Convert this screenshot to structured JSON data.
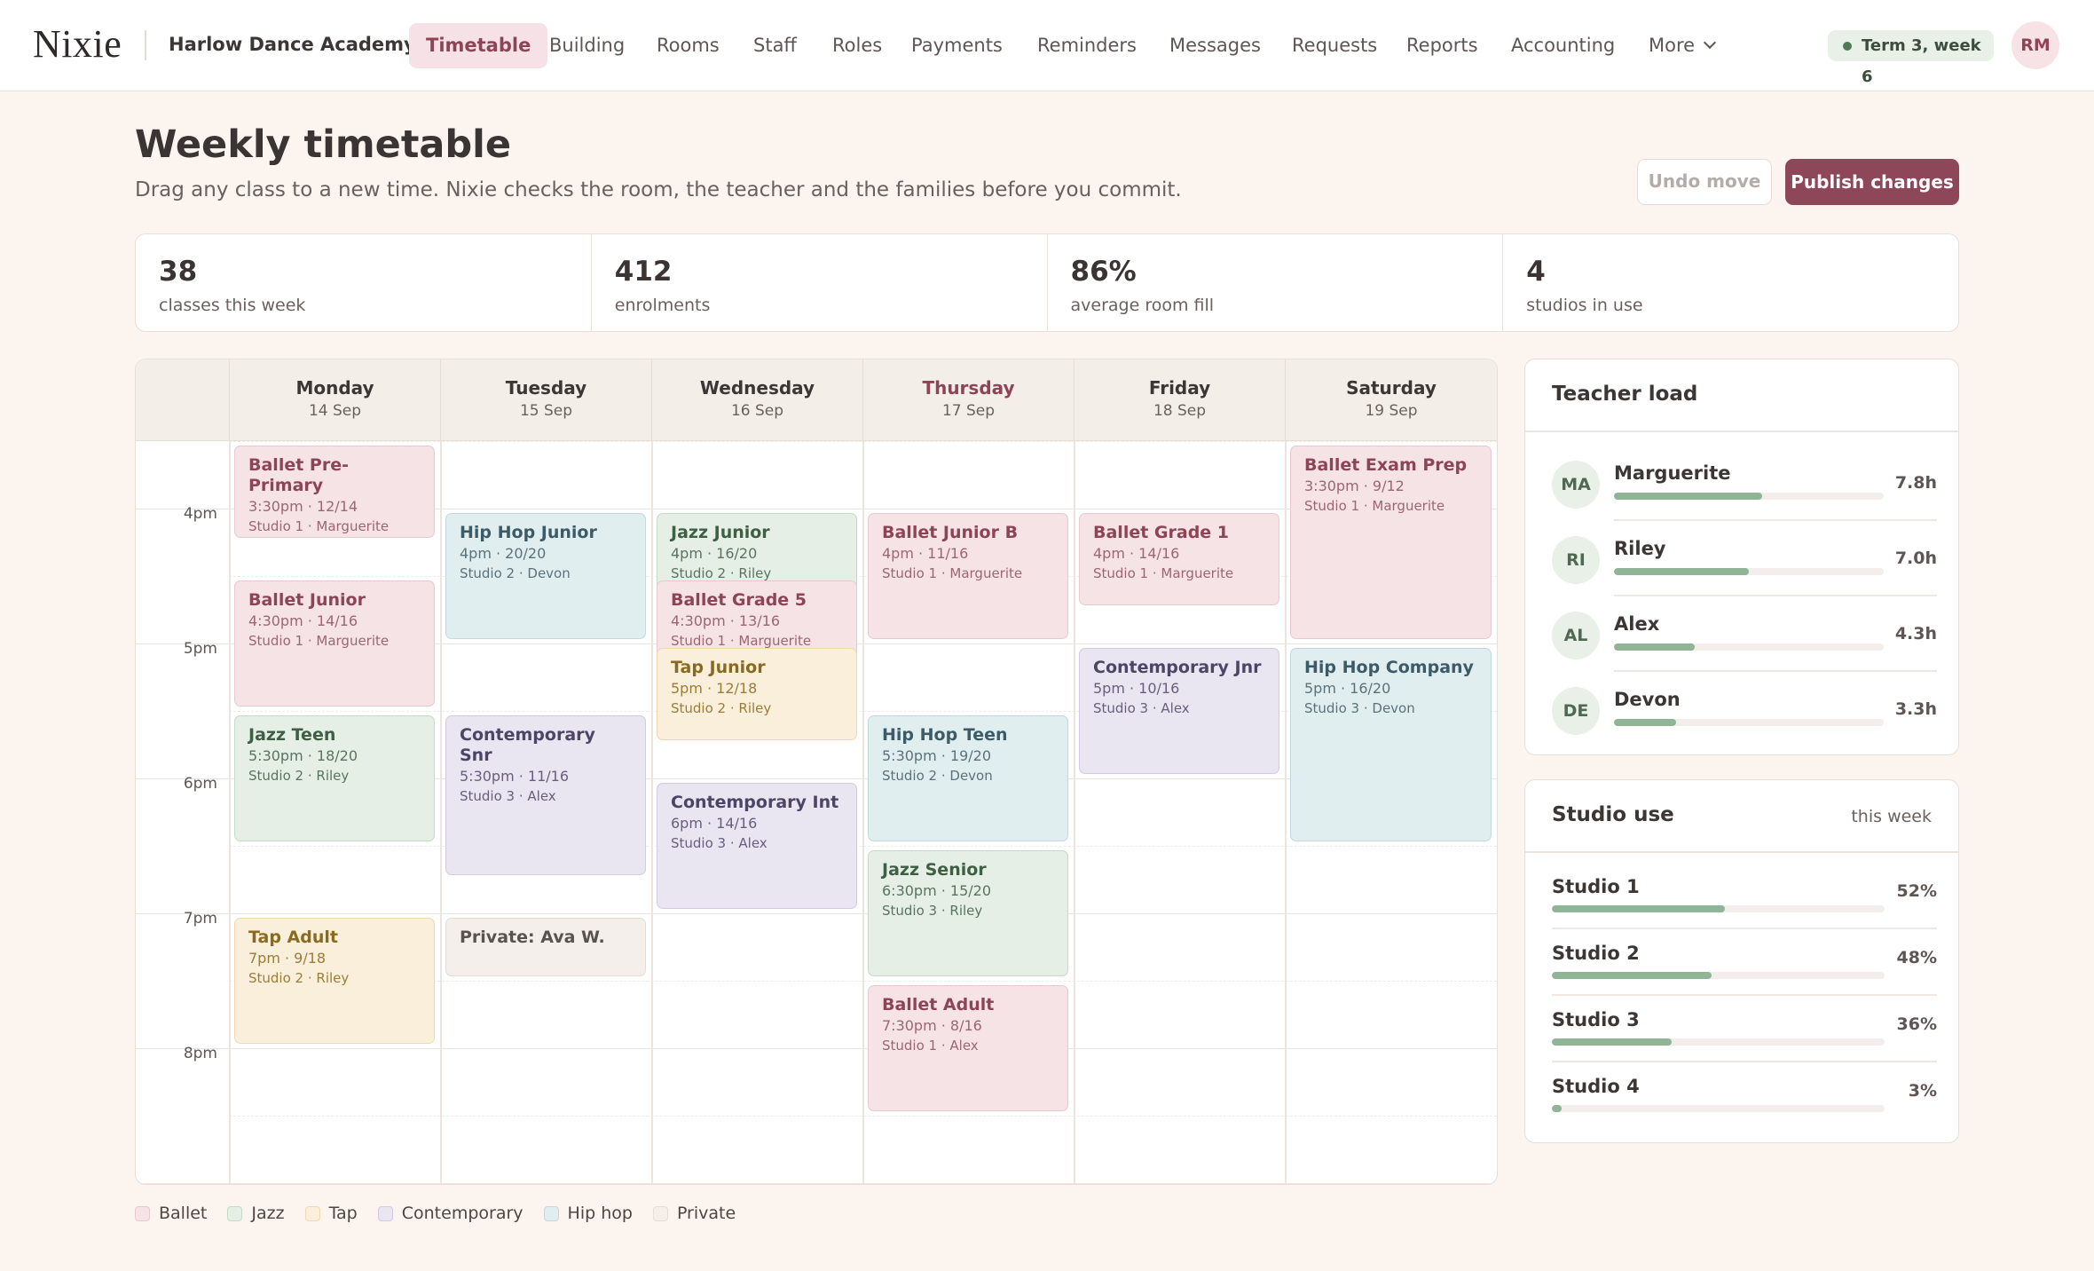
{
  "nav": {
    "logo": "Nixie",
    "org": "Harlow Dance Academy",
    "tabs": [
      {
        "label": "Timetable",
        "active": true
      },
      {
        "label": "Building"
      },
      {
        "label": "Rooms"
      },
      {
        "label": "Staff"
      },
      {
        "label": "Roles"
      },
      {
        "label": "Payments"
      },
      {
        "label": "Reminders"
      },
      {
        "label": "Messages"
      },
      {
        "label": "Requests"
      },
      {
        "label": "Reports"
      },
      {
        "label": "Accounting"
      }
    ],
    "more": "More",
    "term": "Term 3, week 6",
    "user_initials": "RM"
  },
  "page": {
    "title": "Weekly timetable",
    "subtitle": "Drag any class to a new time. Nixie checks the room, the teacher and the families before you commit.",
    "undo": "Undo move",
    "publish": "Publish changes"
  },
  "stats": [
    {
      "value": "38",
      "label": "classes this week"
    },
    {
      "value": "412",
      "label": "enrolments"
    },
    {
      "value": "86%",
      "label": "average room fill"
    },
    {
      "value": "4",
      "label": "studios in use"
    }
  ],
  "calendar": {
    "days": [
      {
        "name": "Monday",
        "date": "14 Sep"
      },
      {
        "name": "Tuesday",
        "date": "15 Sep"
      },
      {
        "name": "Wednesday",
        "date": "16 Sep"
      },
      {
        "name": "Thursday",
        "date": "17 Sep",
        "today": true
      },
      {
        "name": "Friday",
        "date": "18 Sep"
      },
      {
        "name": "Saturday",
        "date": "19 Sep"
      }
    ],
    "time_labels": [
      "4pm",
      "5pm",
      "6pm",
      "7pm",
      "8pm"
    ],
    "events": [
      {
        "day": 0,
        "start": "3:30pm",
        "end": "4:15pm",
        "title": "Ballet Pre-Primary",
        "meta": "3:30pm · 12/14",
        "sub": "Studio 1 · Marguerite",
        "style": "ballet"
      },
      {
        "day": 0,
        "start": "4:30pm",
        "end": "5:30pm",
        "title": "Ballet Junior",
        "meta": "4:30pm · 14/16",
        "sub": "Studio 1 · Marguerite",
        "style": "ballet"
      },
      {
        "day": 0,
        "start": "5:30pm",
        "end": "6:30pm",
        "title": "Jazz Teen",
        "meta": "5:30pm · 18/20",
        "sub": "Studio 2 · Riley",
        "style": "jazz"
      },
      {
        "day": 0,
        "start": "7pm",
        "end": "8pm",
        "title": "Tap Adult",
        "meta": "7pm · 9/18",
        "sub": "Studio 2 · Riley",
        "style": "tap"
      },
      {
        "day": 1,
        "start": "4pm",
        "end": "5pm",
        "title": "Hip Hop Junior",
        "meta": "4pm · 20/20",
        "sub": "Studio 2 · Devon",
        "style": "hiphop"
      },
      {
        "day": 1,
        "start": "5:30pm",
        "end": "6:45pm",
        "title": "Contemporary Snr",
        "meta": "5:30pm · 11/16",
        "sub": "Studio 3 · Alex",
        "style": "contemp"
      },
      {
        "day": 1,
        "start": "7pm",
        "end": "7:30pm",
        "title": "Private: Ava W.",
        "meta": "",
        "sub": "",
        "style": "private"
      },
      {
        "day": 2,
        "start": "4pm",
        "end": "4:45pm",
        "title": "Jazz Junior",
        "meta": "4pm · 16/20",
        "sub": "Studio 2 · Riley",
        "style": "jazz"
      },
      {
        "day": 2,
        "start": "4:30pm",
        "end": "5:30pm",
        "title": "Ballet Grade 5",
        "meta": "4:30pm · 13/16",
        "sub": "Studio 1 · Marguerite",
        "style": "ballet"
      },
      {
        "day": 2,
        "start": "5pm",
        "end": "5:45pm",
        "title": "Tap Junior",
        "meta": "5pm · 12/18",
        "sub": "Studio 2 · Riley",
        "style": "tap"
      },
      {
        "day": 2,
        "start": "6pm",
        "end": "7pm",
        "title": "Contemporary Int",
        "meta": "6pm · 14/16",
        "sub": "Studio 3 · Alex",
        "style": "contemp"
      },
      {
        "day": 3,
        "start": "4pm",
        "end": "5pm",
        "title": "Ballet Junior B",
        "meta": "4pm · 11/16",
        "sub": "Studio 1 · Marguerite",
        "style": "ballet"
      },
      {
        "day": 3,
        "start": "5:30pm",
        "end": "6:30pm",
        "title": "Hip Hop Teen",
        "meta": "5:30pm · 19/20",
        "sub": "Studio 2 · Devon",
        "style": "hiphop"
      },
      {
        "day": 3,
        "start": "6:30pm",
        "end": "7:30pm",
        "title": "Jazz Senior",
        "meta": "6:30pm · 15/20",
        "sub": "Studio 3 · Riley",
        "style": "jazz"
      },
      {
        "day": 3,
        "start": "7:30pm",
        "end": "8:30pm",
        "title": "Ballet Adult",
        "meta": "7:30pm · 8/16",
        "sub": "Studio 1 · Alex",
        "style": "ballet"
      },
      {
        "day": 4,
        "start": "4pm",
        "end": "4:45pm",
        "title": "Ballet Grade 1",
        "meta": "4pm · 14/16",
        "sub": "Studio 1 · Marguerite",
        "style": "ballet"
      },
      {
        "day": 4,
        "start": "5pm",
        "end": "6pm",
        "title": "Contemporary Jnr",
        "meta": "5pm · 10/16",
        "sub": "Studio 3 · Alex",
        "style": "contemp"
      },
      {
        "day": 5,
        "start": "3:30pm",
        "end": "5pm",
        "title": "Ballet Exam Prep",
        "meta": "3:30pm · 9/12",
        "sub": "Studio 1 · Marguerite",
        "style": "ballet"
      },
      {
        "day": 5,
        "start": "5pm",
        "end": "6:30pm",
        "title": "Hip Hop Company",
        "meta": "5pm · 16/20",
        "sub": "Studio 3 · Devon",
        "style": "hiphop"
      }
    ]
  },
  "legend": [
    {
      "label": "Ballet",
      "color": "#f5e3e6",
      "border": "#e9c9cf"
    },
    {
      "label": "Jazz",
      "color": "#e5efe5",
      "border": "#c7dac8"
    },
    {
      "label": "Tap",
      "color": "#faefda",
      "border": "#efd9b0"
    },
    {
      "label": "Contemporary",
      "color": "#e9e5f1",
      "border": "#d2cae2"
    },
    {
      "label": "Hip hop",
      "color": "#e1eef0",
      "border": "#c1d9de"
    },
    {
      "label": "Private",
      "color": "#f4efea",
      "border": "#e4dcd5"
    }
  ],
  "teacher_load": {
    "title": "Teacher load",
    "teachers": [
      {
        "initials": "MA",
        "name": "Marguerite",
        "hours": "7.8h",
        "load": 0.55
      },
      {
        "initials": "RI",
        "name": "Riley",
        "hours": "7.0h",
        "load": 0.5
      },
      {
        "initials": "AL",
        "name": "Alex",
        "hours": "4.3h",
        "load": 0.3
      },
      {
        "initials": "DE",
        "name": "Devon",
        "hours": "3.3h",
        "load": 0.23
      }
    ]
  },
  "studio_use": {
    "title": "Studio use",
    "period": "this week",
    "studios": [
      {
        "name": "Studio 1",
        "percent": "52%",
        "fill": 0.52
      },
      {
        "name": "Studio 2",
        "percent": "48%",
        "fill": 0.48
      },
      {
        "name": "Studio 3",
        "percent": "36%",
        "fill": 0.36
      },
      {
        "name": "Studio 4",
        "percent": "3%",
        "fill": 0.03
      }
    ]
  }
}
